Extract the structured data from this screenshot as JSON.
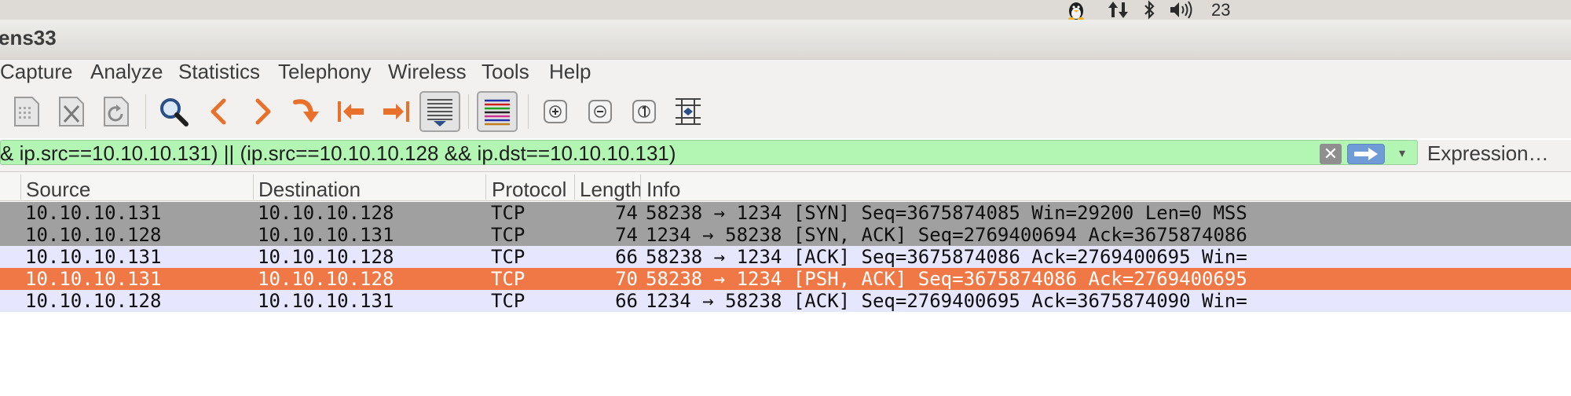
{
  "system_tray": {
    "time": "23",
    "icons": [
      "penguin-icon",
      "network-arrows-icon",
      "bluetooth-icon",
      "volume-icon"
    ]
  },
  "window": {
    "title": "ens33"
  },
  "menu": [
    {
      "label": "Capture"
    },
    {
      "label": "Analyze"
    },
    {
      "label": "Statistics"
    },
    {
      "label": "Telephony"
    },
    {
      "label": "Wireless"
    },
    {
      "label": "Tools"
    },
    {
      "label": "Help"
    }
  ],
  "toolbar": {
    "icons": [
      "open-file-icon",
      "close-file-icon",
      "reload-file-icon",
      "find-packet-icon",
      "go-back-icon",
      "go-forward-icon",
      "go-to-packet-icon",
      "first-packet-icon",
      "last-packet-icon",
      "autoscroll-icon",
      "colorize-icon",
      "zoom-in-icon",
      "zoom-out-icon",
      "normal-size-icon",
      "resize-columns-icon"
    ]
  },
  "filter": {
    "text": "& ip.src==10.10.10.131) || (ip.src==10.10.10.128  && ip.dst==10.10.10.131)",
    "expression_label": "Expression…",
    "background": "#b3f5b3"
  },
  "columns": [
    "Source",
    "Destination",
    "Protocol",
    "Length",
    "Info"
  ],
  "packets": [
    {
      "source": "10.10.10.131",
      "destination": "10.10.10.128",
      "protocol": "TCP",
      "length": "74",
      "info": "58238 → 1234 [SYN] Seq=3675874085 Win=29200 Len=0 MSS",
      "bg": "#a0a0a0",
      "fg": "#101010"
    },
    {
      "source": "10.10.10.128",
      "destination": "10.10.10.131",
      "protocol": "TCP",
      "length": "74",
      "info": "1234 → 58238 [SYN, ACK] Seq=2769400694 Ack=3675874086",
      "bg": "#a0a0a0",
      "fg": "#101010"
    },
    {
      "source": "10.10.10.131",
      "destination": "10.10.10.128",
      "protocol": "TCP",
      "length": "66",
      "info": "58238 → 1234 [ACK] Seq=3675874086 Ack=2769400695 Win=",
      "bg": "#e7e6ff",
      "fg": "#101010"
    },
    {
      "source": "10.10.10.131",
      "destination": "10.10.10.128",
      "protocol": "TCP",
      "length": "70",
      "info": "58238 → 1234 [PSH, ACK] Seq=3675874086 Ack=2769400695",
      "bg": "#f07746",
      "fg": "#ffffff"
    },
    {
      "source": "10.10.10.128",
      "destination": "10.10.10.131",
      "protocol": "TCP",
      "length": "66",
      "info": "1234 → 58238 [ACK] Seq=2769400695 Ack=3675874090 Win=",
      "bg": "#e7e6ff",
      "fg": "#101010"
    }
  ]
}
